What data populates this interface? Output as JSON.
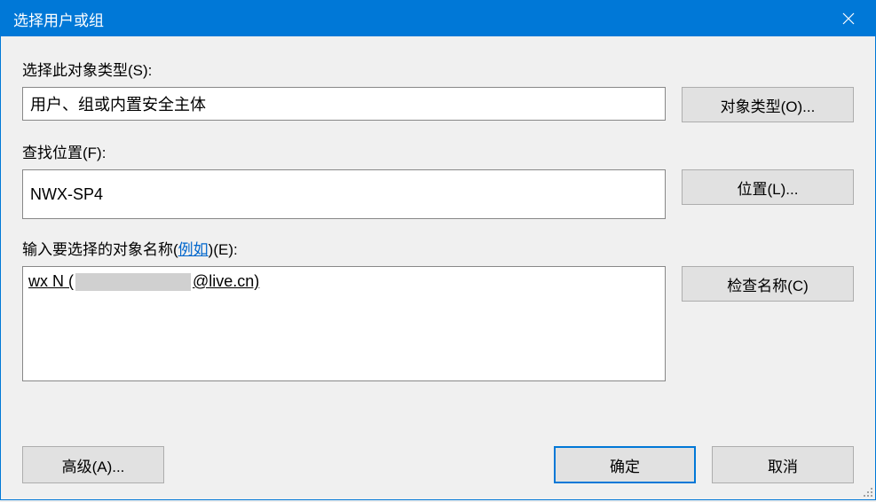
{
  "title": "选择用户或组",
  "object_type": {
    "label": "选择此对象类型(S):",
    "value": "用户、组或内置安全主体",
    "button": "对象类型(O)..."
  },
  "location": {
    "label": "查找位置(F):",
    "value": "NWX-SP4",
    "button": "位置(L)..."
  },
  "names": {
    "label_prefix": "输入要选择的对象名称(",
    "label_link": "例如",
    "label_suffix": ")(E):",
    "value_prefix": "wx N (",
    "value_suffix": "@live.cn)",
    "button": "检查名称(C)"
  },
  "buttons": {
    "advanced": "高级(A)...",
    "ok": "确定",
    "cancel": "取消"
  }
}
